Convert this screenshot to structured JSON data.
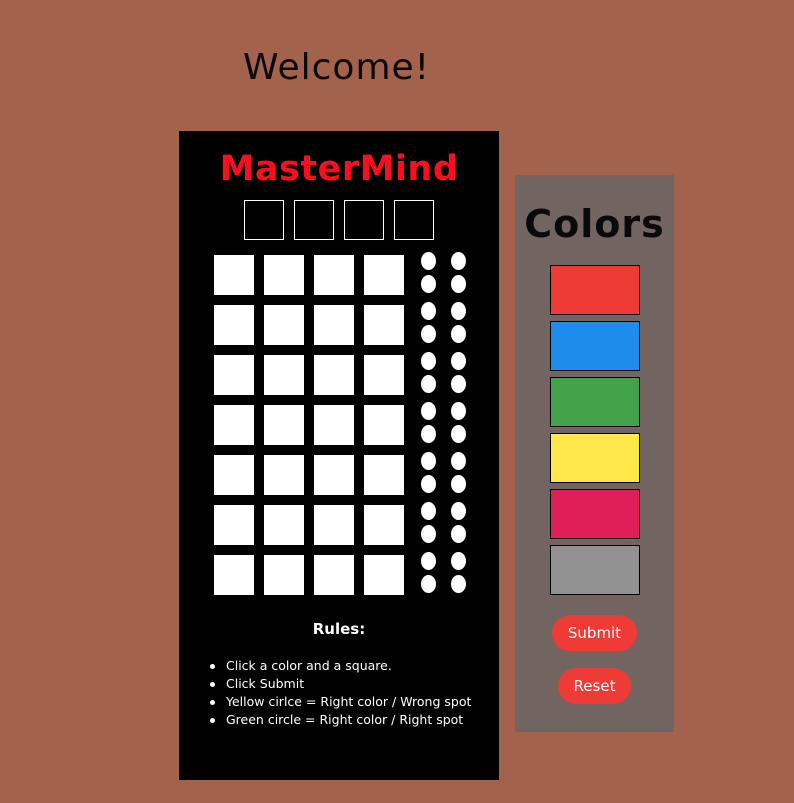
{
  "header": {
    "welcome": "Welcome!"
  },
  "board": {
    "title": "MasterMind",
    "title_color": "#ff0c1e",
    "background": "#000000",
    "secret_slots": 4,
    "guess_rows": 7,
    "pegs_per_row": 4,
    "hint_pegs_per_row": 4
  },
  "rules": {
    "title": "Rules:",
    "items": [
      "Click a color and a square.",
      "Click Submit",
      "Yellow cirlce = Right color / Wrong spot",
      "Green circle = Right color / Right spot"
    ]
  },
  "palette": {
    "title": "Colors",
    "background": "#726461",
    "colors": [
      {
        "name": "red",
        "hex": "#ef3b36"
      },
      {
        "name": "blue",
        "hex": "#1e8ceb"
      },
      {
        "name": "green",
        "hex": "#44a24b"
      },
      {
        "name": "yellow",
        "hex": "#fee84a"
      },
      {
        "name": "pink",
        "hex": "#e01e58"
      },
      {
        "name": "gray",
        "hex": "#929292"
      }
    ]
  },
  "controls": {
    "submit_label": "Submit",
    "reset_label": "Reset",
    "button_color": "#ef3b36"
  },
  "page": {
    "background": "#a3624b"
  }
}
